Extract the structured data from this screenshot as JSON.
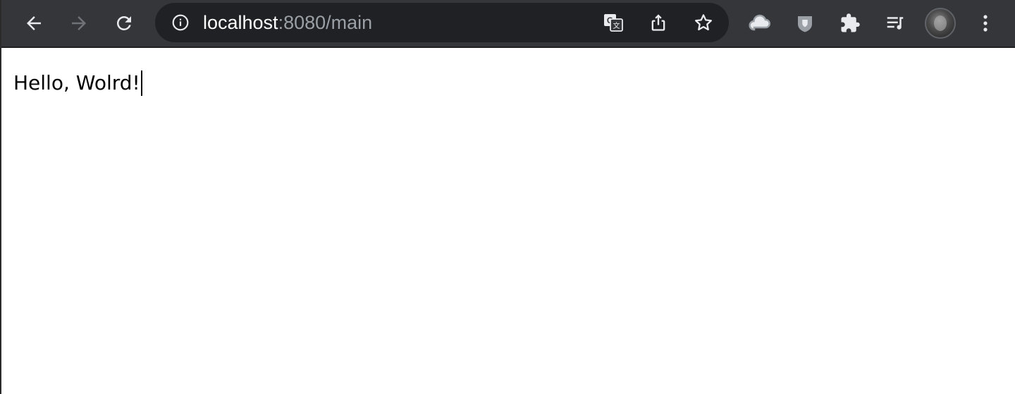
{
  "browser": {
    "nav": {
      "back_icon": "arrow-left-icon",
      "forward_icon": "arrow-right-icon",
      "forward_enabled": false,
      "reload_icon": "reload-icon"
    },
    "address_bar": {
      "security_icon": "info-icon",
      "host": "localhost",
      "rest": ":8080/main",
      "actions": [
        "translate-icon",
        "share-icon",
        "star-icon"
      ]
    },
    "extensions": [
      "cloud-icon",
      "shield-icon",
      "puzzle-icon",
      "media-queue-icon"
    ],
    "profile_icon": "avatar",
    "menu_icon": "kebab-menu-icon"
  },
  "page": {
    "text": "Hello, Wolrd!"
  },
  "colors": {
    "toolbar_bg": "#35363a",
    "omnibox_bg": "#202124",
    "url_host": "#ffffff",
    "url_rest": "#9aa0a6",
    "icon": "#e8eaed",
    "icon_disabled": "#6f7378",
    "page_bg": "#ffffff",
    "page_text": "#000000"
  }
}
